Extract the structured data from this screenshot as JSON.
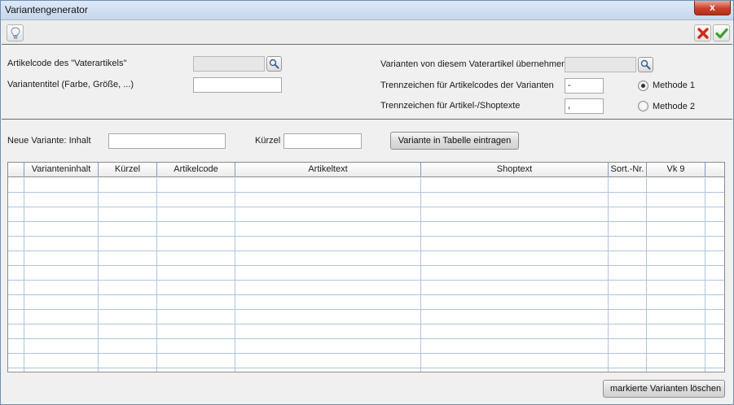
{
  "window": {
    "title": "Variantengenerator",
    "close_label": "x"
  },
  "toolbar": {
    "hint_icon": "lightbulb-icon",
    "cancel_icon": "red-x-icon",
    "confirm_icon": "green-check-icon"
  },
  "form": {
    "parent_code_label": "Artikelcode des \"Vaterartikels\"",
    "parent_code_value": "",
    "variant_title_label": "Variantentitel (Farbe, Größe, ...)",
    "variant_title_value": "",
    "copy_variants_label": "Varianten von diesem Vaterartikel übernehmen",
    "copy_variants_value": "",
    "sep_codes_label": "Trennzeichen für Artikelcodes der Varianten",
    "sep_codes_value": "-",
    "sep_texts_label": "Trennzeichen für Artikel-/Shoptexte",
    "sep_texts_value": ",",
    "method1_label": "Methode 1",
    "method2_label": "Methode 2",
    "method_selected": "Methode 1"
  },
  "new_variant": {
    "content_label": "Neue Variante: Inhalt",
    "content_value": "",
    "short_label": "Kürzel",
    "short_value": "",
    "add_button": "Variante in Tabelle eintragen"
  },
  "table": {
    "columns": [
      "Varianteninhalt",
      "Kürzel",
      "Artikelcode",
      "Artikeltext",
      "Shoptext",
      "Sort.-Nr.",
      "Vk 9"
    ],
    "rows": []
  },
  "footer": {
    "delete_button": "markierte Varianten löschen"
  }
}
